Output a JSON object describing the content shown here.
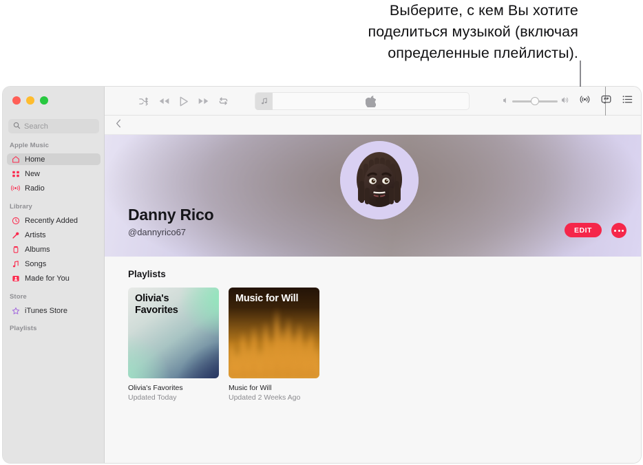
{
  "callout": {
    "lines": [
      "Выберите, с кем Вы хотите",
      "поделиться музыкой (включая",
      "определенные плейлисты)."
    ],
    "text": "Выберите, с кем Вы хотите поделиться музыкой (включая определенные плейлисты)."
  },
  "window": {
    "traffic_lights": [
      "close",
      "minimize",
      "zoom"
    ]
  },
  "sidebar": {
    "search": {
      "placeholder": "Search",
      "value": "",
      "icon": "search-icon"
    },
    "sections": [
      {
        "label": "Apple Music",
        "items": [
          {
            "label": "Home",
            "icon": "home-icon",
            "active": true
          },
          {
            "label": "New",
            "icon": "grid-new-icon",
            "active": false
          },
          {
            "label": "Radio",
            "icon": "radio-broadcast-icon",
            "active": false
          }
        ]
      },
      {
        "label": "Library",
        "items": [
          {
            "label": "Recently Added",
            "icon": "clock-icon",
            "active": false
          },
          {
            "label": "Artists",
            "icon": "microphone-icon",
            "active": false
          },
          {
            "label": "Albums",
            "icon": "album-icon",
            "active": false
          },
          {
            "label": "Songs",
            "icon": "music-note-icon",
            "active": false
          },
          {
            "label": "Made for You",
            "icon": "person-card-icon",
            "active": false
          }
        ]
      },
      {
        "label": "Store",
        "items": [
          {
            "label": "iTunes Store",
            "icon": "star-icon",
            "active": false
          }
        ]
      },
      {
        "label": "Playlists",
        "items": []
      }
    ]
  },
  "toolbar": {
    "controls": [
      {
        "name": "shuffle-button",
        "icon": "shuffle-icon"
      },
      {
        "name": "previous-button",
        "icon": "rewind-icon"
      },
      {
        "name": "play-button",
        "icon": "play-icon"
      },
      {
        "name": "next-button",
        "icon": "fast-forward-icon"
      },
      {
        "name": "repeat-button",
        "icon": "repeat-icon"
      }
    ],
    "now_playing": {
      "artwork_icon": "music-note-icon",
      "center_icon": "apple-logo-icon",
      "title": "",
      "subtitle": ""
    },
    "volume": {
      "level_percent": 45,
      "min_icon": "speaker-low-icon",
      "max_icon": "speaker-high-icon"
    },
    "right_icons": [
      {
        "name": "airplay-button",
        "icon": "airplay-icon"
      },
      {
        "name": "lyrics-button",
        "icon": "lyrics-bubble-icon"
      },
      {
        "name": "queue-button",
        "icon": "queue-list-icon"
      }
    ]
  },
  "navbar": {
    "back_icon": "chevron-left-icon"
  },
  "profile": {
    "name": "Danny Rico",
    "handle": "@dannyrico67",
    "avatar_alt": "memoji-avatar",
    "edit_label": "EDIT",
    "more_label": "…",
    "accent_color": "#f5274a"
  },
  "main": {
    "section_title": "Playlists",
    "playlists": [
      {
        "artwork_label": "Olivia's\nFavorites",
        "artwork_label_line1": "Olivia's",
        "artwork_label_line2": "Favorites",
        "title": "Olivia's Favorites",
        "subtitle": "Updated Today",
        "artwork_style": "mesh-gradient-mint-navy"
      },
      {
        "artwork_label": "Music for Will",
        "artwork_label_line1": "Music for Will",
        "artwork_label_line2": "",
        "title": "Music for Will",
        "subtitle": "Updated 2 Weeks Ago",
        "artwork_style": "equalizer-bars-amber"
      }
    ]
  },
  "eq_bar_heights": [
    42,
    30,
    52,
    38,
    58,
    34,
    64,
    46,
    78,
    56,
    68,
    50,
    62,
    44,
    54,
    36
  ]
}
